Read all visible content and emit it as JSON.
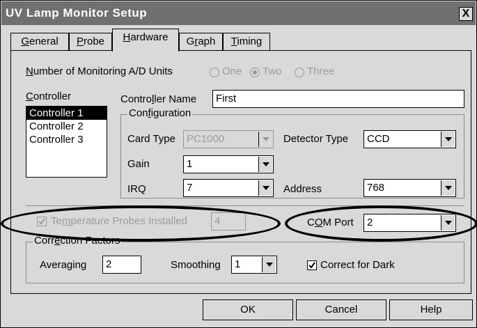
{
  "window": {
    "title": "UV Lamp Monitor Setup",
    "close": "X"
  },
  "tabs": [
    {
      "label": "General",
      "ul": "G",
      "rest": "eneral"
    },
    {
      "label": "Probe",
      "ul": "P",
      "rest": "robe"
    },
    {
      "label": "Hardware",
      "ul": "H",
      "rest": "ardware",
      "active": true
    },
    {
      "label": "Graph",
      "pre": "G",
      "ul": "r",
      "rest": "aph"
    },
    {
      "label": "Timing",
      "ul": "T",
      "rest": "iming"
    }
  ],
  "units": {
    "label_ul": "N",
    "label_rest": "umber of Monitoring A/D Units",
    "options": [
      "One",
      "Two",
      "Three"
    ],
    "selected": "Two"
  },
  "controller": {
    "label_ul": "C",
    "label_rest": "ontroller",
    "items": [
      "Controller 1",
      "Controller 2",
      "Controller 3"
    ],
    "selected": "Controller 1",
    "name_label_pre": "Contro",
    "name_label_ul": "l",
    "name_label_rest": "ler Name",
    "name_value": "First"
  },
  "configuration": {
    "label_pre": "Con",
    "label_ul": "f",
    "label_rest": "iguration",
    "card_type_label": "Card Type",
    "card_type_value": "PC1000",
    "detector_type_label": "Detector Type",
    "detector_type_value": "CCD",
    "gain_label": "Gain",
    "gain_value": "1",
    "irq_label": "IRQ",
    "irq_value": "7",
    "address_label": "Address",
    "address_value": "768"
  },
  "temperature": {
    "label_pre": "Te",
    "label_ul": "m",
    "label_rest": "perature Probes Installed",
    "checked": true,
    "value": "4"
  },
  "com_port": {
    "label_pre": "C",
    "label_ul": "O",
    "label_rest": "M Port",
    "value": "2"
  },
  "correction": {
    "label_pre": "Corr",
    "label_ul": "e",
    "label_rest": "ction Factors",
    "averaging_label": "Averaging",
    "averaging_value": "2",
    "smoothing_label": "Smoothing",
    "smoothing_value": "1",
    "correct_dark_label": "Correct for Dark",
    "correct_dark_checked": true
  },
  "buttons": {
    "ok": "OK",
    "cancel": "Cancel",
    "help": "Help"
  }
}
